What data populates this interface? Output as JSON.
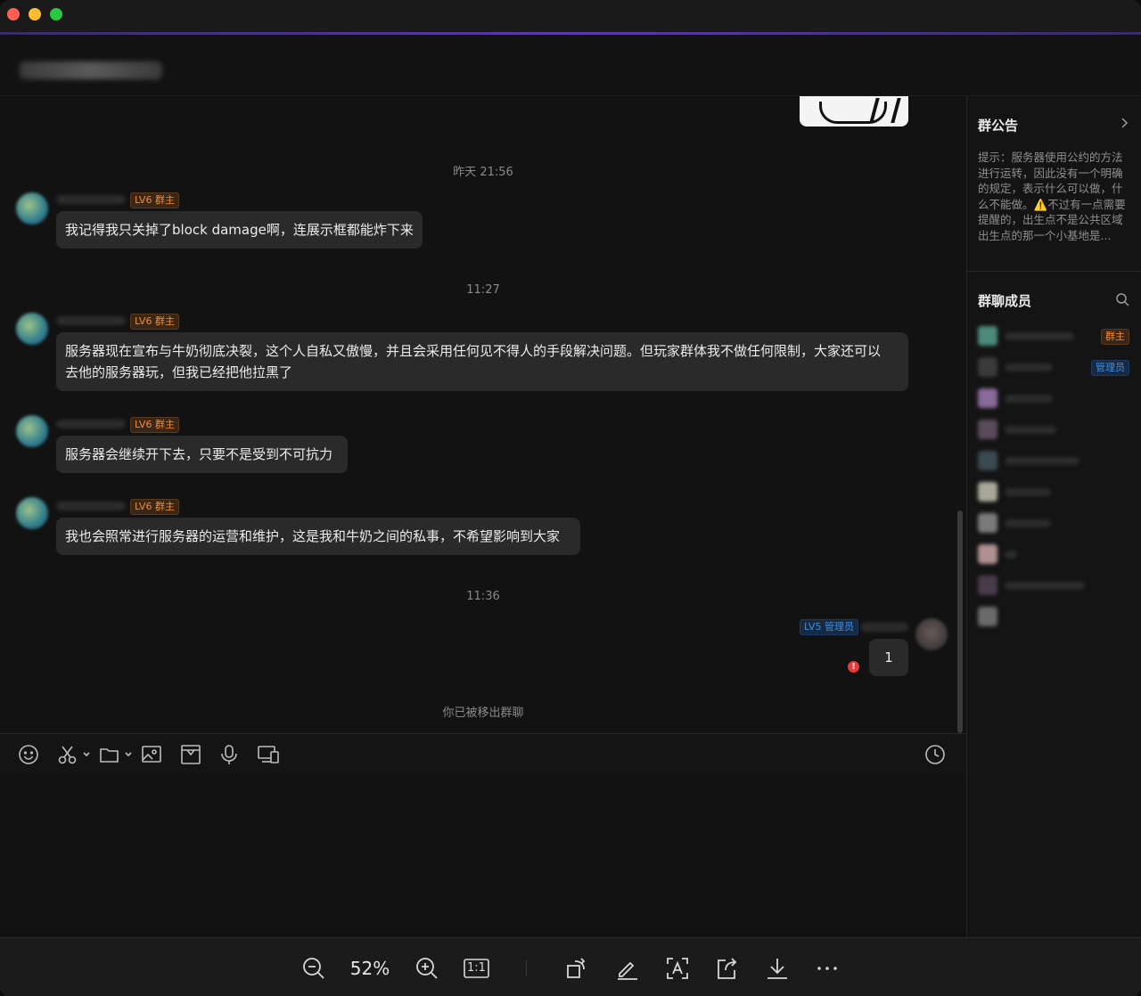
{
  "window": {
    "traffic_lights": {
      "close_color": "#ff5f57",
      "minimize_color": "#febc2e",
      "zoom_color": "#28c840"
    }
  },
  "chat": {
    "messages": [
      {
        "time": "昨天 21:56",
        "badge": "LV6 群主",
        "text": "我记得我只关掉了block damage啊，连展示框都能炸下来"
      },
      {
        "time": "11:27",
        "badge": "LV6 群主",
        "text_line1": "服务器现在宣布与牛奶彻底决裂，这个人自私又傲慢，并且会采用任何见不得人的手段解决问题。但玩家群体我不做任何限制，大家还可以",
        "text_line2": "去他的服务器玩，但我已经把他拉黑了"
      },
      {
        "badge": "LV6 群主",
        "text": "服务器会继续开下去，只要不是受到不可抗力"
      },
      {
        "badge": "LV6 群主",
        "text": "我也会照常进行服务器的运营和维护，这是我和牛奶之间的私事，不希望影响到大家"
      }
    ],
    "my_message": {
      "time": "11:36",
      "badge": "LV5 管理员",
      "text": "1",
      "error_mark": "!"
    },
    "notice": "你已被移出群聊"
  },
  "toolbar": {
    "icons": [
      "emoji-icon",
      "scissors-icon",
      "folder-icon",
      "image-icon",
      "box-icon",
      "microphone-icon",
      "screen-share-icon",
      "history-clock-icon"
    ]
  },
  "sidebar": {
    "announcement_title": "群公告",
    "announcement_text_a": "提示：服务器使用公约的方法进行运转，因此没有一个明确的规定，表示什么可以做，什么不能做。",
    "announcement_warn": "⚠️",
    "announcement_text_b": "不过有一点需要提醒的，出生点不是公共区域出生点的那一个小基地是...",
    "members_title": "群聊成员",
    "member_badges": {
      "owner": "群主",
      "admin": "管理员"
    }
  },
  "viewer_bar": {
    "zoom_level": "52%",
    "actual_size_label": "1:1"
  }
}
